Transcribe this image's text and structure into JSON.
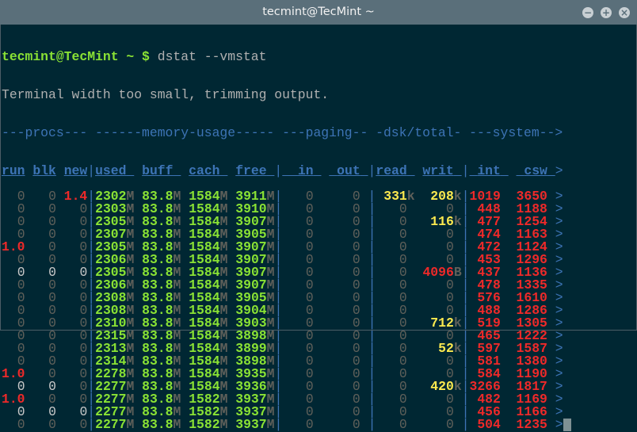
{
  "window": {
    "title": "tecmint@TecMint ~",
    "minimize": "−",
    "maximize": "+",
    "close": "×"
  },
  "prompt": {
    "user_host": "tecmint@TecMint",
    "path": " ~ $ ",
    "command": "dstat --vmstat"
  },
  "warning": "Terminal width too small, trimming output.",
  "group_header": "---procs--- ------memory-usage----- ---paging-- -dsk/total- ---system-->",
  "columns": [
    "run",
    "blk",
    "new",
    "used",
    "buff",
    "cach",
    "free",
    "in",
    "out",
    "read",
    "writ",
    "int",
    "csw"
  ],
  "more_indicator": ">",
  "memory_unit": "M",
  "rows": [
    {
      "procs": [
        "0",
        "0",
        "1.4"
      ],
      "bright": [
        0,
        0,
        0
      ],
      "mem": [
        "2302",
        "83.8",
        "1584",
        "3911"
      ],
      "paging": [
        "0",
        "0"
      ],
      "read": "331",
      "read_unit": "k",
      "writ": "208",
      "writ_unit": "k",
      "int": "1019",
      "csw": "3650"
    },
    {
      "procs": [
        "0",
        "0",
        "0"
      ],
      "bright": [
        0,
        0,
        0
      ],
      "mem": [
        "2303",
        "83.8",
        "1584",
        "3910"
      ],
      "paging": [
        "0",
        "0"
      ],
      "read": "0",
      "read_unit": "",
      "writ": "0",
      "writ_unit": "",
      "int": "448",
      "csw": "1188"
    },
    {
      "procs": [
        "0",
        "0",
        "0"
      ],
      "bright": [
        0,
        0,
        0
      ],
      "mem": [
        "2305",
        "83.8",
        "1584",
        "3907"
      ],
      "paging": [
        "0",
        "0"
      ],
      "read": "0",
      "read_unit": "",
      "writ": "116",
      "writ_unit": "k",
      "int": "477",
      "csw": "1254"
    },
    {
      "procs": [
        "0",
        "0",
        "0"
      ],
      "bright": [
        0,
        0,
        0
      ],
      "mem": [
        "2307",
        "83.8",
        "1584",
        "3905"
      ],
      "paging": [
        "0",
        "0"
      ],
      "read": "0",
      "read_unit": "",
      "writ": "0",
      "writ_unit": "",
      "int": "474",
      "csw": "1163"
    },
    {
      "procs": [
        "1.0",
        "0",
        "0"
      ],
      "bright": [
        0,
        0,
        0
      ],
      "mem": [
        "2305",
        "83.8",
        "1584",
        "3907"
      ],
      "paging": [
        "0",
        "0"
      ],
      "read": "0",
      "read_unit": "",
      "writ": "0",
      "writ_unit": "",
      "int": "472",
      "csw": "1124"
    },
    {
      "procs": [
        "0",
        "0",
        "0"
      ],
      "bright": [
        0,
        0,
        0
      ],
      "mem": [
        "2306",
        "83.8",
        "1584",
        "3907"
      ],
      "paging": [
        "0",
        "0"
      ],
      "read": "0",
      "read_unit": "",
      "writ": "0",
      "writ_unit": "",
      "int": "453",
      "csw": "1296"
    },
    {
      "procs": [
        "0",
        "0",
        "0"
      ],
      "bright": [
        1,
        1,
        1
      ],
      "mem": [
        "2305",
        "83.8",
        "1584",
        "3907"
      ],
      "paging": [
        "0",
        "0"
      ],
      "read": "0",
      "read_unit": "",
      "writ": "4096",
      "writ_unit": "B",
      "int": "437",
      "csw": "1136"
    },
    {
      "procs": [
        "0",
        "0",
        "0"
      ],
      "bright": [
        0,
        0,
        0
      ],
      "mem": [
        "2306",
        "83.8",
        "1584",
        "3907"
      ],
      "paging": [
        "0",
        "0"
      ],
      "read": "0",
      "read_unit": "",
      "writ": "0",
      "writ_unit": "",
      "int": "478",
      "csw": "1335"
    },
    {
      "procs": [
        "0",
        "0",
        "0"
      ],
      "bright": [
        0,
        0,
        0
      ],
      "mem": [
        "2308",
        "83.8",
        "1584",
        "3905"
      ],
      "paging": [
        "0",
        "0"
      ],
      "read": "0",
      "read_unit": "",
      "writ": "0",
      "writ_unit": "",
      "int": "576",
      "csw": "1610"
    },
    {
      "procs": [
        "0",
        "0",
        "0"
      ],
      "bright": [
        0,
        0,
        0
      ],
      "mem": [
        "2308",
        "83.8",
        "1584",
        "3904"
      ],
      "paging": [
        "0",
        "0"
      ],
      "read": "0",
      "read_unit": "",
      "writ": "0",
      "writ_unit": "",
      "int": "488",
      "csw": "1286"
    },
    {
      "procs": [
        "0",
        "0",
        "0"
      ],
      "bright": [
        0,
        0,
        0
      ],
      "mem": [
        "2310",
        "83.8",
        "1584",
        "3903"
      ],
      "paging": [
        "0",
        "0"
      ],
      "read": "0",
      "read_unit": "",
      "writ": "712",
      "writ_unit": "k",
      "int": "519",
      "csw": "1305"
    },
    {
      "procs": [
        "0",
        "0",
        "0"
      ],
      "bright": [
        0,
        0,
        0
      ],
      "mem": [
        "2315",
        "83.8",
        "1584",
        "3898"
      ],
      "paging": [
        "0",
        "0"
      ],
      "read": "0",
      "read_unit": "",
      "writ": "0",
      "writ_unit": "",
      "int": "465",
      "csw": "1222"
    },
    {
      "procs": [
        "0",
        "0",
        "0"
      ],
      "bright": [
        0,
        0,
        0
      ],
      "mem": [
        "2313",
        "83.8",
        "1584",
        "3899"
      ],
      "paging": [
        "0",
        "0"
      ],
      "read": "0",
      "read_unit": "",
      "writ": "52",
      "writ_unit": "k",
      "int": "597",
      "csw": "1587"
    },
    {
      "procs": [
        "0",
        "0",
        "0"
      ],
      "bright": [
        0,
        0,
        0
      ],
      "mem": [
        "2314",
        "83.8",
        "1584",
        "3898"
      ],
      "paging": [
        "0",
        "0"
      ],
      "read": "0",
      "read_unit": "",
      "writ": "0",
      "writ_unit": "",
      "int": "581",
      "csw": "1380"
    },
    {
      "procs": [
        "1.0",
        "0",
        "0"
      ],
      "bright": [
        0,
        0,
        0
      ],
      "mem": [
        "2278",
        "83.8",
        "1584",
        "3935"
      ],
      "paging": [
        "0",
        "0"
      ],
      "read": "0",
      "read_unit": "",
      "writ": "0",
      "writ_unit": "",
      "int": "584",
      "csw": "1190"
    },
    {
      "procs": [
        "0",
        "0",
        "0"
      ],
      "bright": [
        1,
        1,
        0
      ],
      "mem": [
        "2277",
        "83.8",
        "1584",
        "3936"
      ],
      "paging": [
        "0",
        "0"
      ],
      "read": "0",
      "read_unit": "",
      "writ": "420",
      "writ_unit": "k",
      "int": "3266",
      "csw": "1817"
    },
    {
      "procs": [
        "1.0",
        "0",
        "0"
      ],
      "bright": [
        0,
        0,
        0
      ],
      "mem": [
        "2277",
        "83.8",
        "1582",
        "3937"
      ],
      "paging": [
        "0",
        "0"
      ],
      "read": "0",
      "read_unit": "",
      "writ": "0",
      "writ_unit": "",
      "int": "482",
      "csw": "1169"
    },
    {
      "procs": [
        "0",
        "0",
        "0"
      ],
      "bright": [
        1,
        1,
        1
      ],
      "mem": [
        "2277",
        "83.8",
        "1582",
        "3937"
      ],
      "paging": [
        "0",
        "0"
      ],
      "read": "0",
      "read_unit": "",
      "writ": "0",
      "writ_unit": "",
      "int": "456",
      "csw": "1166"
    },
    {
      "procs": [
        "0",
        "0",
        "0"
      ],
      "bright": [
        0,
        0,
        0
      ],
      "mem": [
        "2277",
        "83.8",
        "1582",
        "3937"
      ],
      "paging": [
        "0",
        "0"
      ],
      "read": "0",
      "read_unit": "",
      "writ": "0",
      "writ_unit": "",
      "int": "504",
      "csw": "1235"
    }
  ]
}
